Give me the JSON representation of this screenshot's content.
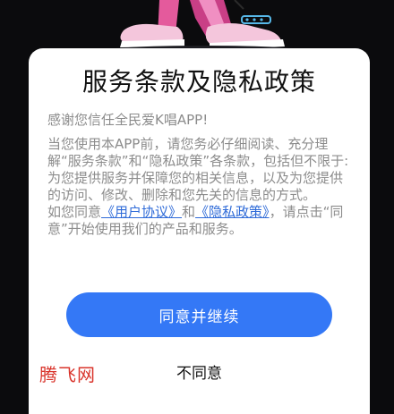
{
  "dialog": {
    "title": "服务条款及隐私政策",
    "greeting": "感谢您信任全民爱K唱APP!",
    "body_paragraph": "当您使用本APP前，请您务必仔细阅读、充分理解“服务条款”和“隐私政策”各条款，包括但不限于:为您提供服务并保障您的相关信息，以及为您提供的访问、修改、删除和您先关的信息的方式。",
    "consent_prefix": "如您同意",
    "user_agreement_link": "《用户协议》",
    "and_word": "和",
    "privacy_policy_link": "《隐私政策》",
    "consent_suffix": "，请点击“同意”开始使用我们的产品和服务。",
    "agree_button": "同意并继续",
    "decline_button": "不同意"
  },
  "watermark": "腾飞网",
  "colors": {
    "background": "#0b0b0d",
    "dialog": "#ffffff",
    "primary_button": "#3478f6",
    "link": "#2f6bd8",
    "watermark": "#d9342b",
    "muted_text": "#8c8c8c"
  },
  "icons": {
    "background_art": "cartoon-character-sneakers-illustration"
  }
}
